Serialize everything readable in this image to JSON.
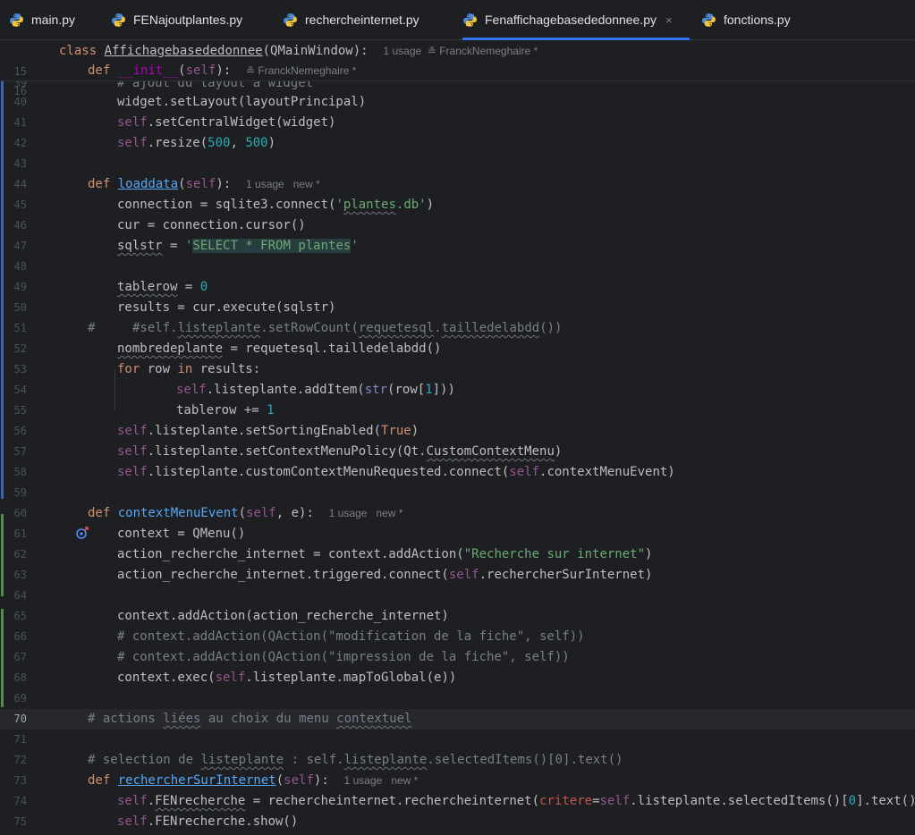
{
  "tabs": [
    {
      "label": "main.py",
      "active": false
    },
    {
      "label": "FENajoutplantes.py",
      "active": false
    },
    {
      "label": "rechercheinternet.py",
      "active": false
    },
    {
      "label": "Fenaffichagebasededonnee.py",
      "active": true
    },
    {
      "label": "fonctions.py",
      "active": false
    }
  ],
  "close_glyph": "×",
  "sticky": {
    "line15": {
      "num": "15",
      "kw": "class ",
      "name": "Affichagebasededonnee",
      "rest": "(QMainWindow):",
      "hint": "1 usage  ≗ FranckNemeghaire *"
    },
    "line16": {
      "num": "16",
      "kw": "def ",
      "name": "__init__",
      "open": "(",
      "self": "self",
      "close": "):",
      "hint": "≗ FranckNemeghaire *"
    }
  },
  "lines": {
    "l39": {
      "num": "39",
      "text": "# ajout du layout à widget"
    },
    "l40": {
      "num": "40",
      "text": "widget.setLayout(layoutPrincipal)"
    },
    "l41": {
      "num": "41",
      "self": "self",
      "text": ".setCentralWidget(widget)"
    },
    "l42": {
      "num": "42",
      "self": "self",
      "a": ".resize(",
      "n1": "500",
      ", ": ", ",
      "n2": "500",
      "b": ")"
    },
    "l43": {
      "num": "43"
    },
    "l44": {
      "num": "44",
      "kw": "def ",
      "name": "loaddata",
      "open": "(",
      "self": "self",
      "close": "):",
      "hint": "1 usage   new *"
    },
    "l45": {
      "num": "45",
      "a": "connection = sqlite3.connect(",
      "str1": "'",
      "strU": "plantes",
      "str2": ".db'",
      "b": ")"
    },
    "l46": {
      "num": "46",
      "text": "cur = connection.cursor()"
    },
    "l47": {
      "num": "47",
      "var": "sqlstr",
      "a": " = ",
      "q": "'",
      "sql": "SELECT * FROM plantes",
      "q2": "'"
    },
    "l48": {
      "num": "48"
    },
    "l49": {
      "num": "49",
      "var": "tablerow",
      "a": " = ",
      "n": "0"
    },
    "l50": {
      "num": "50",
      "text": "results = cur.execute(sqlstr)"
    },
    "l51": {
      "num": "51",
      "hash": "#",
      "c1": "#self.",
      "cu1": "listeplante",
      "c2": ".setRowCount(",
      "cu2": "requetesql",
      "c3": ".",
      "cu3": "tailledelabdd",
      "c4": "())"
    },
    "l52": {
      "num": "52",
      "var": "nombredeplante",
      "a": " = requetesql.tailledelabdd()"
    },
    "l53": {
      "num": "53",
      "kw": "for ",
      "a": "row ",
      "kw2": "in ",
      "b": "results:"
    },
    "l54": {
      "num": "54",
      "self": "self",
      "a": ".listeplante.addItem(",
      "fn": "str",
      "b": "(row[",
      "n": "1",
      "c": "]))"
    },
    "l55": {
      "num": "55",
      "a": "tablerow += ",
      "n": "1"
    },
    "l56": {
      "num": "56",
      "self": "self",
      "a": ".listeplante.setSortingEnabled(",
      "kw": "True",
      "b": ")"
    },
    "l57": {
      "num": "57",
      "self": "self",
      "a": ".listeplante.setContextMenuPolicy(Qt.",
      "u": "CustomContextMenu",
      "b": ")"
    },
    "l58": {
      "num": "58",
      "self": "self",
      "a": ".listeplante.customContextMenuRequested.connect(",
      "self2": "self",
      "b": ".contextMenuEvent)"
    },
    "l59": {
      "num": "59"
    },
    "l60": {
      "num": "60",
      "kw": "def ",
      "name": "contextMenuEvent",
      "open": "(",
      "self": "self",
      ", ": ", ",
      "param": "e",
      "close": "):",
      "hint": "1 usage   new *"
    },
    "l61": {
      "num": "61",
      "text": "context = QMenu()"
    },
    "l62": {
      "num": "62",
      "a": "action_recherche_internet = context.addAction(",
      "str": "\"Recherche sur internet\"",
      "b": ")"
    },
    "l63": {
      "num": "63",
      "a": "action_recherche_internet.triggered.connect(",
      "self": "self",
      "b": ".rechercherSurInternet)"
    },
    "l64": {
      "num": "64"
    },
    "l65": {
      "num": "65",
      "text": "context.addAction(action_recherche_internet)"
    },
    "l66": {
      "num": "66",
      "cm": "# context.addAction(QAction(\"modification de la fiche\", self))"
    },
    "l67": {
      "num": "67",
      "cm": "# context.addAction(QAction(\"impression de la fiche\", self))"
    },
    "l68": {
      "num": "68",
      "a": "context.exec(",
      "self": "self",
      "b": ".listeplante.mapToGlobal(e))"
    },
    "l69": {
      "num": "69"
    },
    "l70": {
      "num": "70",
      "c1": "# actions ",
      "cu1": "liées",
      "c2": " au choix du menu ",
      "cu2": "contextuel"
    },
    "l71": {
      "num": "71"
    },
    "l72": {
      "num": "72",
      "c1": "# selection de ",
      "cu1": "listeplante",
      "c2": " : self.",
      "cu2": "listeplante",
      "c3": ".selectedItems()[0].text()"
    },
    "l73": {
      "num": "73",
      "kw": "def ",
      "name": "rechercherSurInternet",
      "open": "(",
      "self": "self",
      "close": "):",
      "hint": "1 usage   new *"
    },
    "l74": {
      "num": "74",
      "self": "self",
      "a": ".",
      "u": "FENrecherche",
      "b": " = rechercheinternet.rechercheinternet(",
      "kwarg": "critere",
      "eq": "=",
      "self2": "self",
      "c": ".listeplante.selectedItems()[",
      "n": "0",
      "d": "].text())"
    },
    "l75": {
      "num": "75",
      "self": "self",
      "a": ".FENrecherche.show()"
    }
  },
  "colors": {
    "accent": "#3574f0",
    "keyword": "#cf8e6d",
    "function": "#56a8f5",
    "self": "#94558d",
    "string": "#6aab73",
    "number": "#2aacb8",
    "comment": "#7a7e85"
  },
  "icons": {
    "tab_file": "python-file-icon",
    "line60": "override-implemented-icon",
    "line69": "intention-bulb-icon"
  }
}
